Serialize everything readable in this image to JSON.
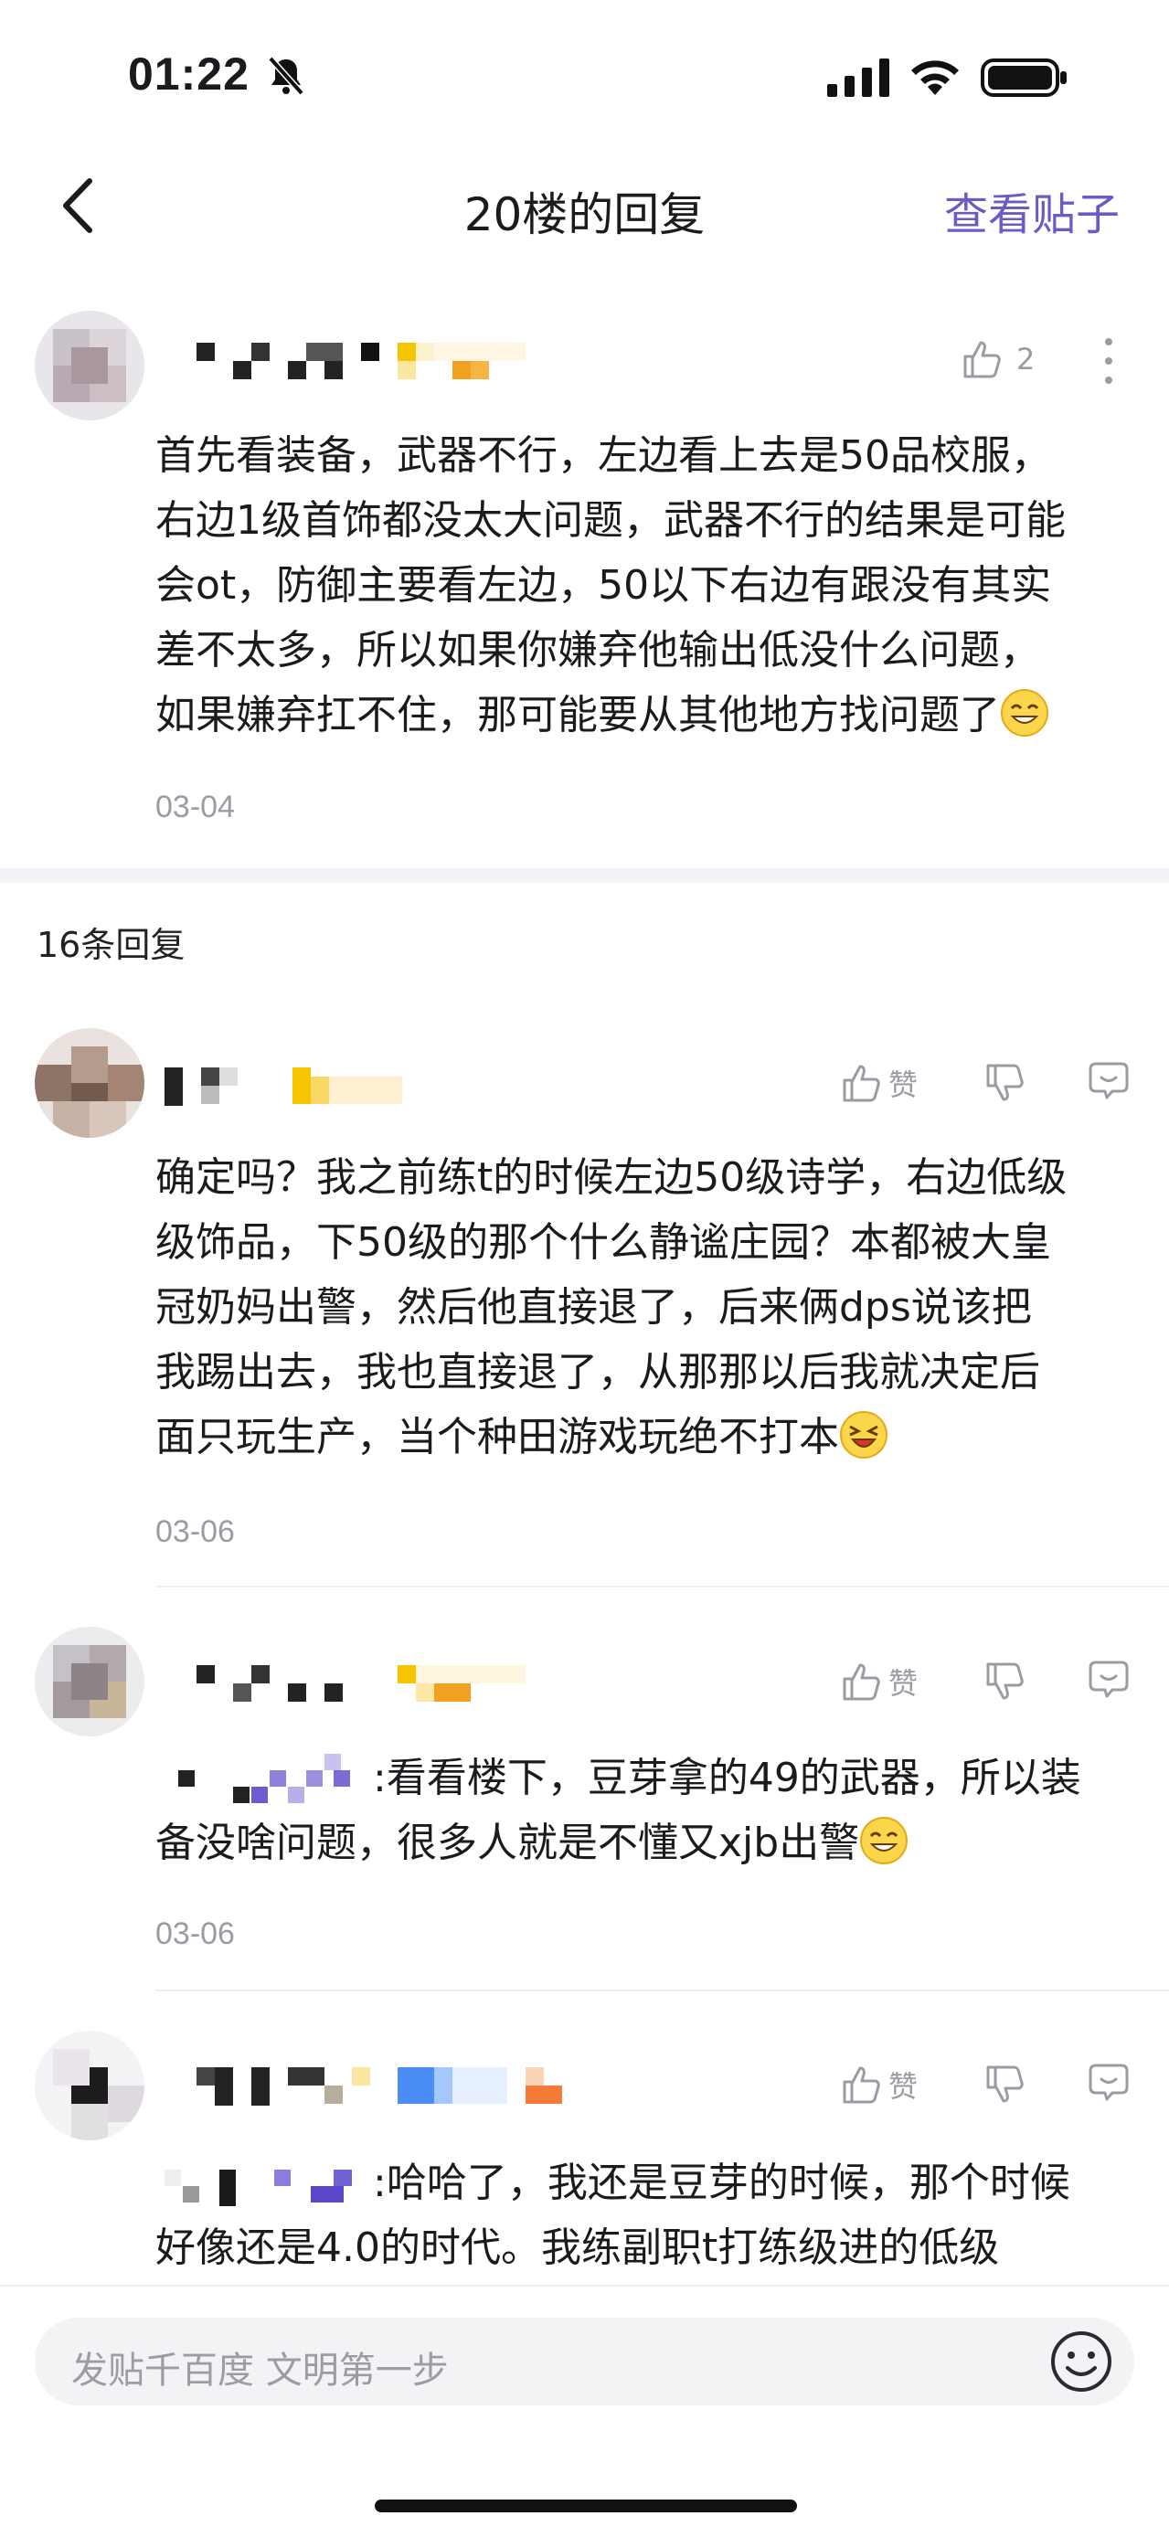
{
  "status_bar": {
    "time": "01:22"
  },
  "nav": {
    "title": "20楼的回复",
    "action": "查看贴子"
  },
  "main_post": {
    "like_count": "2",
    "lines": [
      "首先看装备，武器不行，左边看上去是50品校服，",
      "右边1级首饰都没太大问题，武器不行的结果是可能",
      "会ot，防御主要看左边，50以下右边有跟没有其实",
      "差不太多，所以如果你嫌弃他输出低没什么问题，",
      "如果嫌弃扛不住，那可能要从其他地方找问题了"
    ],
    "date": "03-04"
  },
  "replies_header": "16条回复",
  "replies": [
    {
      "like_label": "赞",
      "lines": [
        "确定吗？我之前练t的时候左边50级诗学，右边低级",
        "级饰品，下50级的那个什么静谧庄园？本都被大皇",
        "冠奶妈出警，然后他直接退了，后来俩dps说该把",
        "我踢出去，我也直接退了，从那那以后我就决定后",
        "面只玩生产，当个种田游戏玩绝不打本"
      ],
      "date": "03-06"
    },
    {
      "like_label": "赞",
      "lines": [
        ":看看楼下，豆芽拿的49的武器，所以装",
        "备没啥问题，很多人就是不懂又xjb出警"
      ],
      "date": "03-06"
    },
    {
      "like_label": "赞",
      "lines": [
        ":哈哈了，我还是豆芽的时候，那个时候",
        "好像还是4.0的时代。我练副职t打练级进的低级"
      ]
    }
  ],
  "input": {
    "placeholder": "发贴千百度 文明第一步"
  },
  "colors": {
    "accent": "#6c5bc4",
    "muted": "#9b9ba6"
  }
}
